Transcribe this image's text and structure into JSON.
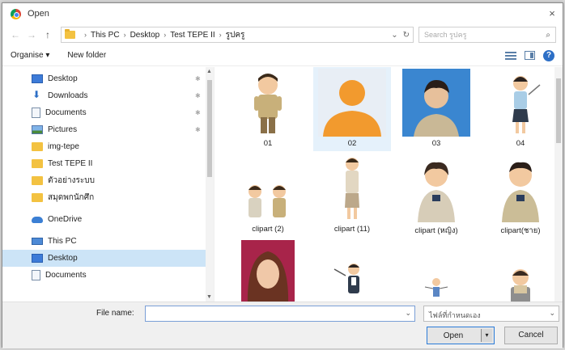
{
  "window": {
    "title": "Open",
    "close_glyph": "×"
  },
  "nav": {
    "back_glyph": "←",
    "forward_glyph": "→",
    "up_glyph": "↑",
    "breadcrumb": [
      "This PC",
      "Desktop",
      "Test TEPE II",
      "รูปครู"
    ],
    "separator": "›",
    "refresh_glyph": "↻",
    "dropdown_glyph": "⌄",
    "search_placeholder": "Search รูปครู",
    "search_icon_glyph": "⌕"
  },
  "toolbar": {
    "organise_label": "Organise ▾",
    "new_folder_label": "New folder",
    "help_glyph": "?"
  },
  "sidebar": {
    "items": [
      {
        "label": "Desktop",
        "icon": "desktop-icon",
        "pinned": true
      },
      {
        "label": "Downloads",
        "icon": "download-icon",
        "pinned": true
      },
      {
        "label": "Documents",
        "icon": "documents-icon",
        "pinned": true
      },
      {
        "label": "Pictures",
        "icon": "pictures-icon",
        "pinned": true
      },
      {
        "label": "img-tepe",
        "icon": "folder-icon",
        "pinned": false
      },
      {
        "label": "Test TEPE II",
        "icon": "folder-icon",
        "pinned": false
      },
      {
        "label": "ตัวอย่างระบบ",
        "icon": "folder-icon",
        "pinned": false
      },
      {
        "label": "สมุดพกนักศึก",
        "icon": "folder-icon",
        "pinned": false
      },
      {
        "label": "OneDrive",
        "icon": "onedrive-icon",
        "pinned": false
      },
      {
        "label": "This PC",
        "icon": "this-pc-icon",
        "pinned": false
      },
      {
        "label": "Desktop",
        "icon": "desktop-icon",
        "pinned": false,
        "selected": true
      },
      {
        "label": "Documents",
        "icon": "documents-icon",
        "pinned": false
      }
    ],
    "pin_glyph": "✱"
  },
  "files": [
    {
      "name": "01",
      "art": "cartoon-officer"
    },
    {
      "name": "02",
      "art": "silhouette",
      "selected": true
    },
    {
      "name": "03",
      "art": "photo-blue"
    },
    {
      "name": "04",
      "art": "cartoon-woman"
    },
    {
      "name": "clipart (2)",
      "art": "cartoon-pair"
    },
    {
      "name": "clipart (11)",
      "art": "cartoon-standing"
    },
    {
      "name": "clipart (หญิง)",
      "art": "cartoon-female"
    },
    {
      "name": "clipart(ชาย)",
      "art": "cartoon-male"
    },
    {
      "name": "",
      "art": "photo-woman"
    },
    {
      "name": "",
      "art": "cartoon-teacher"
    },
    {
      "name": "",
      "art": "cartoon-small"
    },
    {
      "name": "",
      "art": "cartoon-reader"
    }
  ],
  "footer": {
    "file_name_label": "File name:",
    "file_name_value": "",
    "file_type_value": "ไฟล์ที่กำหนดเอง",
    "open_label": "Open",
    "cancel_label": "Cancel",
    "dropdown_glyph": "⌄",
    "split_glyph": "▾"
  },
  "colors": {
    "accent": "#2b7bd8",
    "selection": "#cce4f7",
    "silhouette": "#f29a2e",
    "photo_bg": "#3a86d0"
  }
}
